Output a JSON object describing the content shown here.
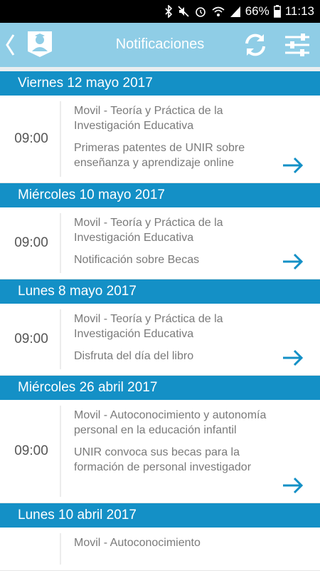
{
  "status_bar": {
    "battery": "66%",
    "time": "11:13"
  },
  "header": {
    "title": "Notificaciones",
    "accent": "#8fcde6"
  },
  "colors": {
    "date_bar": "#1490c6",
    "arrow": "#1490c6"
  },
  "groups": [
    {
      "date": "Viernes 12 mayo 2017",
      "items": [
        {
          "time": "09:00",
          "course": "Movil - Teoría y Práctica de la Investigación Educativa",
          "message": "Primeras patentes de UNIR sobre enseñanza y aprendizaje online"
        }
      ]
    },
    {
      "date": "Miércoles 10 mayo 2017",
      "items": [
        {
          "time": "09:00",
          "course": "Movil - Teoría y Práctica de la Investigación Educativa",
          "message": "Notificación sobre Becas"
        }
      ]
    },
    {
      "date": "Lunes 8 mayo 2017",
      "items": [
        {
          "time": "09:00",
          "course": "Movil - Teoría y Práctica de la Investigación Educativa",
          "message": "Disfruta del día del libro"
        }
      ]
    },
    {
      "date": "Miércoles 26 abril 2017",
      "items": [
        {
          "time": "09:00",
          "course": "Movil - Autoconocimiento y autonomía personal en la educación infantil",
          "message": "UNIR convoca sus becas para la formación de personal investigador"
        }
      ]
    },
    {
      "date": "Lunes 10 abril 2017",
      "items": [
        {
          "time": "",
          "course": "Movil - Autoconocimiento",
          "message": ""
        }
      ]
    }
  ]
}
